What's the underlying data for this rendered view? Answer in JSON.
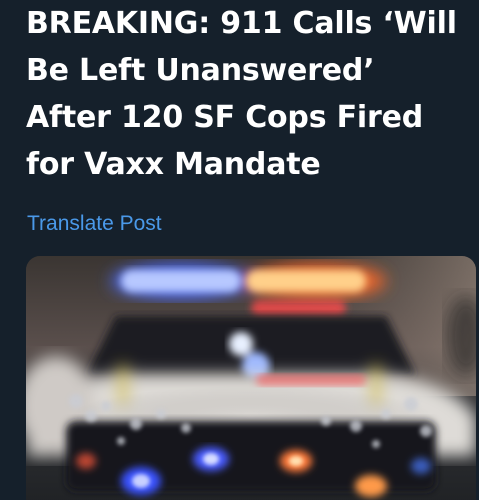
{
  "post": {
    "headline_lines": [
      "BREAKING: 911 Calls ‘Will",
      "Be Left Unanswered’",
      "After 120 SF Cops Fired",
      "for Vaxx Mandate"
    ],
    "translate_label": "Translate Post"
  },
  "colors": {
    "background": "#15202b",
    "headline_text": "#ffffff",
    "link": "#4a99e9"
  },
  "media": {
    "subject": "blurred police car with flashing emergency lights"
  }
}
